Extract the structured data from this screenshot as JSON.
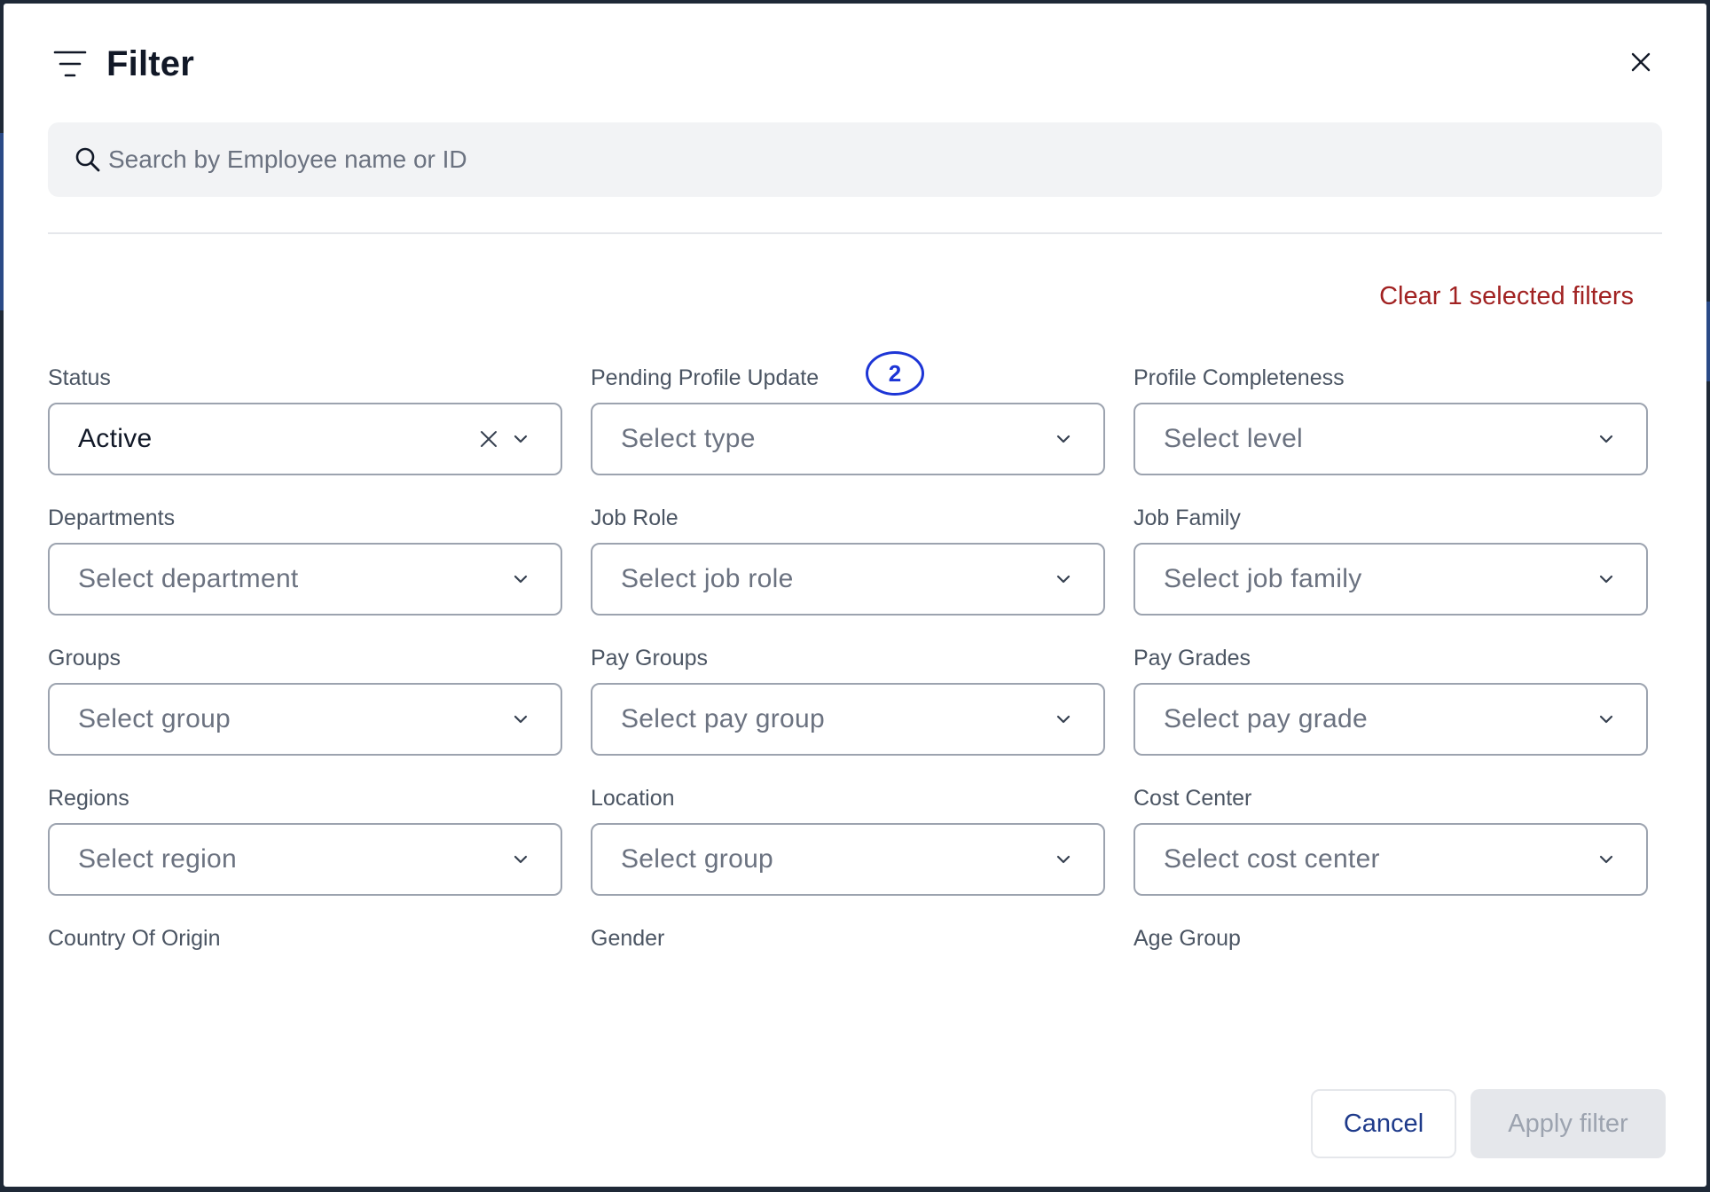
{
  "header": {
    "title": "Filter",
    "icon": "filter-lines-icon",
    "close_icon": "close-icon"
  },
  "search": {
    "placeholder": "Search by Employee name or ID",
    "value": "",
    "icon": "search-icon"
  },
  "clear_filters_label": "Clear 1 selected filters",
  "badge": {
    "value": "2",
    "color": "#1d35d6"
  },
  "fields": [
    {
      "label": "Status",
      "value": "Active",
      "filled": true
    },
    {
      "label": "Pending Profile Update",
      "value": "Select type",
      "filled": false
    },
    {
      "label": "Profile Completeness",
      "value": "Select level",
      "filled": false
    },
    {
      "label": "Departments",
      "value": "Select department",
      "filled": false
    },
    {
      "label": "Job Role",
      "value": "Select job role",
      "filled": false
    },
    {
      "label": "Job Family",
      "value": "Select job family",
      "filled": false
    },
    {
      "label": "Groups",
      "value": "Select group",
      "filled": false
    },
    {
      "label": "Pay Groups",
      "value": "Select pay group",
      "filled": false
    },
    {
      "label": "Pay Grades",
      "value": "Select pay grade",
      "filled": false
    },
    {
      "label": "Regions",
      "value": "Select region",
      "filled": false
    },
    {
      "label": "Location",
      "value": "Select group",
      "filled": false
    },
    {
      "label": "Cost Center",
      "value": "Select cost center",
      "filled": false
    }
  ],
  "trailing_labels": [
    {
      "label": "Country Of Origin"
    },
    {
      "label": "Gender"
    },
    {
      "label": "Age Group"
    }
  ],
  "footer": {
    "cancel_label": "Cancel",
    "apply_label": "Apply filter",
    "apply_disabled": true
  },
  "colors": {
    "accent_link": "#a12222",
    "cancel_text": "#1e3a8a",
    "apply_disabled_bg": "#e5e7eb"
  }
}
